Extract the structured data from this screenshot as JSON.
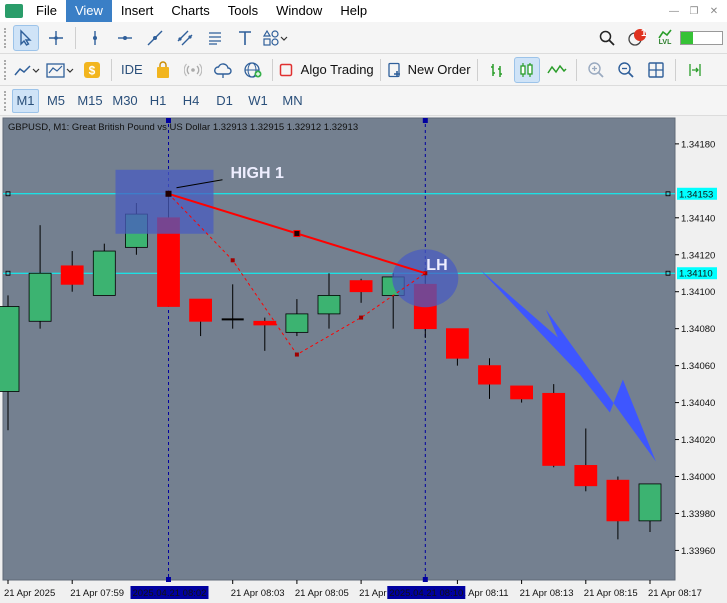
{
  "menu": {
    "items": [
      "File",
      "View",
      "Insert",
      "Charts",
      "Tools",
      "Window",
      "Help"
    ],
    "active_index": 1
  },
  "toolbar2": {
    "ide_label": "IDE",
    "algo_trading_label": "Algo Trading",
    "new_order_label": "New Order"
  },
  "notifications": {
    "count": "1",
    "lvl_label": "LVL"
  },
  "timeframes": {
    "items": [
      "M1",
      "M5",
      "M15",
      "M30",
      "H1",
      "H4",
      "D1",
      "W1",
      "MN"
    ],
    "active_index": 0
  },
  "chart_data": {
    "type": "candlestick",
    "title": "GBPUSD, M1:  Great British Pound vs US Dollar  1.32913 1.32915 1.32912 1.32913",
    "colors": {
      "background": "#748090",
      "bull": "#3cb371",
      "bear": "#ff0000",
      "hline": "#00ffff",
      "vline": "#0000a0",
      "arrow": "#3e56ff",
      "trend": "#ff0000"
    },
    "y_ticks": [
      "1.34180",
      "1.34140",
      "1.34120",
      "1.34100",
      "1.34080",
      "1.34060",
      "1.34040",
      "1.34020",
      "1.34000",
      "1.33980",
      "1.33960"
    ],
    "y_tick_values": [
      1.3418,
      1.3414,
      1.3412,
      1.341,
      1.3408,
      1.3406,
      1.3404,
      1.3402,
      1.34,
      1.3398,
      1.3396
    ],
    "ylim": [
      1.33944,
      1.34194
    ],
    "x_ticks": [
      "21 Apr 2025",
      "21 Apr 07:59",
      "21 Apr 08:03",
      "21 Apr 08:05",
      "21 Apr 08:07",
      "21 Apr 08:11",
      "21 Apr 08:13",
      "21 Apr 08:15",
      "21 Apr 08:17"
    ],
    "x_tick_bars": [
      0,
      2,
      7,
      9,
      11,
      14,
      16,
      18,
      20
    ],
    "x_highlight_labels": [
      "2025.04.21 08:02",
      "2025.04.21 08:10"
    ],
    "x_highlight_bars": [
      5,
      13
    ],
    "price_labels": [
      "1.34153",
      "1.34110"
    ],
    "price_levels": [
      1.34153,
      1.3411
    ],
    "candles": [
      {
        "o": 1.34046,
        "h": 1.34098,
        "l": 1.34025,
        "c": 1.34092
      },
      {
        "o": 1.34084,
        "h": 1.34136,
        "l": 1.3408,
        "c": 1.3411
      },
      {
        "o": 1.34114,
        "h": 1.34122,
        "l": 1.341,
        "c": 1.34104
      },
      {
        "o": 1.34098,
        "h": 1.34126,
        "l": 1.34098,
        "c": 1.34122
      },
      {
        "o": 1.34124,
        "h": 1.34148,
        "l": 1.3412,
        "c": 1.34142
      },
      {
        "o": 1.3414,
        "h": 1.34153,
        "l": 1.341,
        "c": 1.34092
      },
      {
        "o": 1.34096,
        "h": 1.34096,
        "l": 1.34076,
        "c": 1.34084
      },
      {
        "o": 1.34085,
        "h": 1.34104,
        "l": 1.3408,
        "c": 1.34085
      },
      {
        "o": 1.34084,
        "h": 1.34086,
        "l": 1.34068,
        "c": 1.34082
      },
      {
        "o": 1.34078,
        "h": 1.34096,
        "l": 1.34076,
        "c": 1.34088
      },
      {
        "o": 1.34088,
        "h": 1.3411,
        "l": 1.3408,
        "c": 1.34098
      },
      {
        "o": 1.34106,
        "h": 1.34107,
        "l": 1.34094,
        "c": 1.341
      },
      {
        "o": 1.34098,
        "h": 1.3411,
        "l": 1.3408,
        "c": 1.34108
      },
      {
        "o": 1.34104,
        "h": 1.3411,
        "l": 1.34075,
        "c": 1.3408
      },
      {
        "o": 1.3408,
        "h": 1.3408,
        "l": 1.3406,
        "c": 1.34064
      },
      {
        "o": 1.3406,
        "h": 1.34064,
        "l": 1.34042,
        "c": 1.3405
      },
      {
        "o": 1.34049,
        "h": 1.34049,
        "l": 1.3404,
        "c": 1.34042
      },
      {
        "o": 1.34045,
        "h": 1.3405,
        "l": 1.34005,
        "c": 1.34006
      },
      {
        "o": 1.34006,
        "h": 1.34026,
        "l": 1.33992,
        "c": 1.33995
      },
      {
        "o": 1.33998,
        "h": 1.34,
        "l": 1.33966,
        "c": 1.33976
      },
      {
        "o": 1.33976,
        "h": 1.33996,
        "l": 1.3397,
        "c": 1.33996
      }
    ],
    "annotations": [
      {
        "text": "HIGH 1"
      },
      {
        "text": "LH"
      }
    ],
    "trendline": {
      "from_bar": 5,
      "from_price": 1.34153,
      "to_bar": 13,
      "to_price": 1.3411
    },
    "zigzag": [
      {
        "bar": 5,
        "price": 1.34153
      },
      {
        "bar": 7,
        "price": 1.34117
      },
      {
        "bar": 9,
        "price": 1.34066
      },
      {
        "bar": 11,
        "price": 1.34086
      },
      {
        "bar": 13,
        "price": 1.3411
      }
    ]
  }
}
